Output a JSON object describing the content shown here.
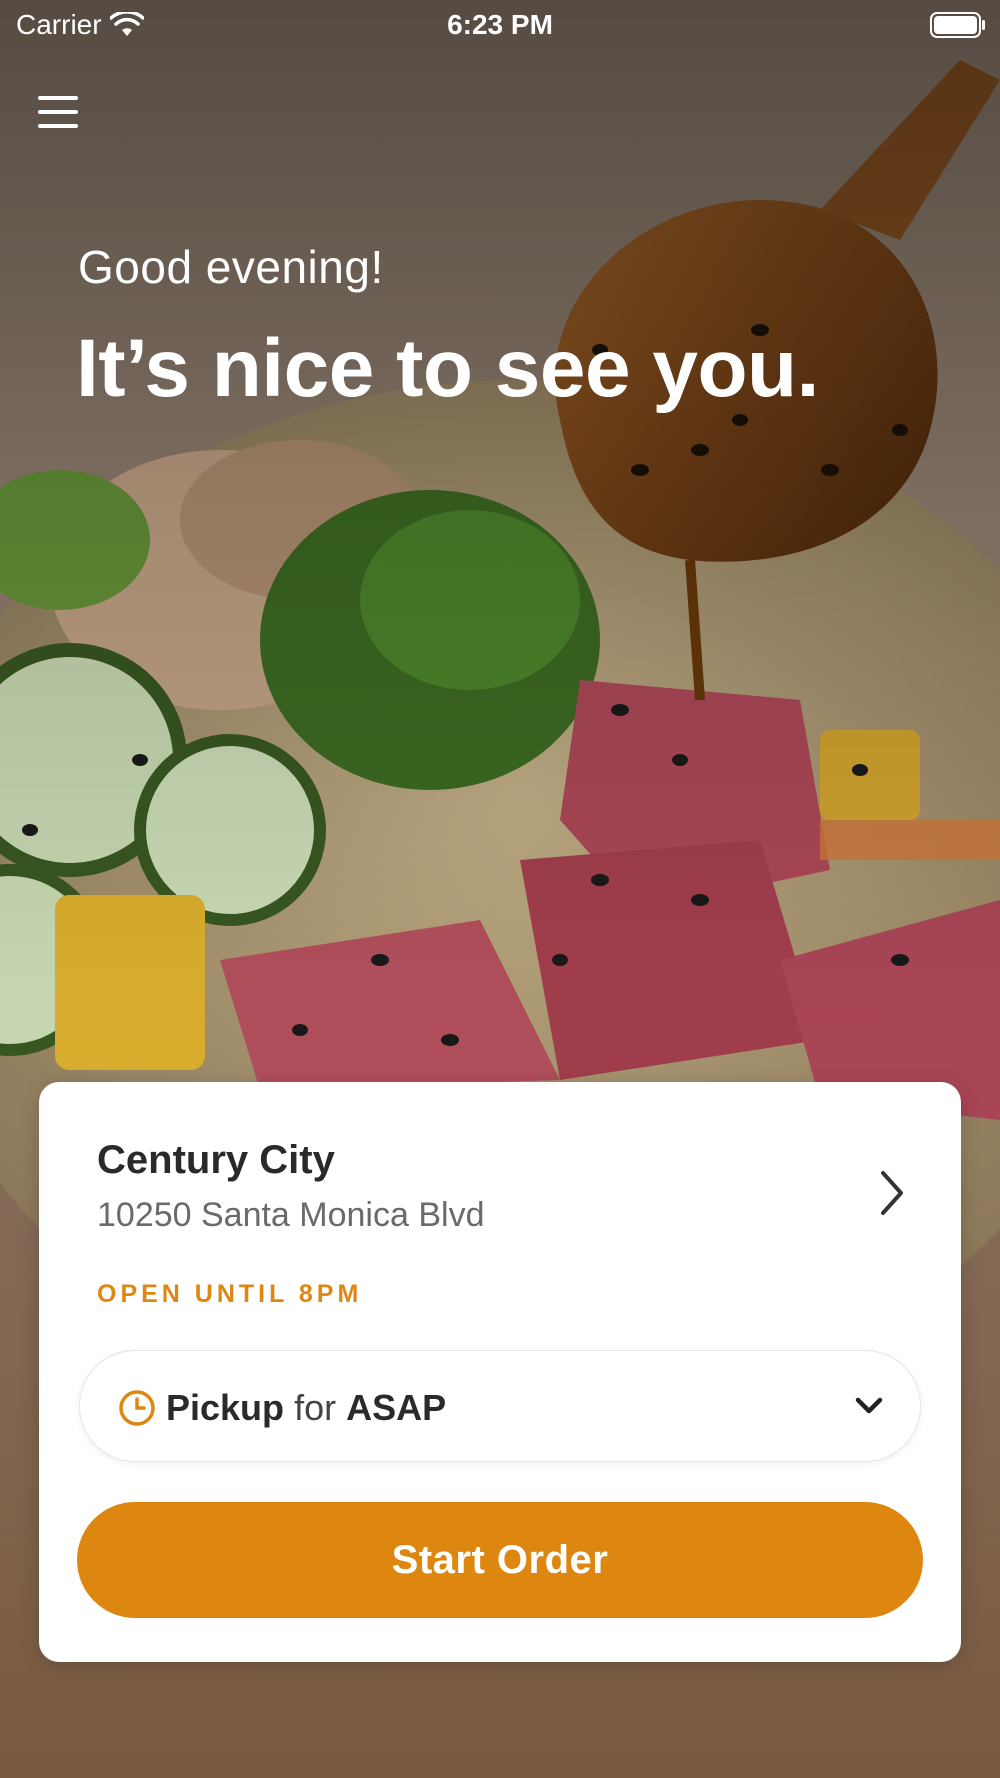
{
  "status_bar": {
    "carrier": "Carrier",
    "time": "6:23 PM"
  },
  "header": {
    "greeting": "Good evening!",
    "headline": "It’s nice to see you."
  },
  "location_card": {
    "name": "Century City",
    "address": "10250 Santa Monica Blvd",
    "hours": "OPEN UNTIL 8PM",
    "pickup": {
      "mode": "Pickup",
      "connector": "for",
      "time": "ASAP"
    },
    "start_button_label": "Start Order"
  },
  "colors": {
    "accent": "#de8710",
    "text_dark": "#2a2a2a",
    "text_muted": "#6a6a6a"
  },
  "icons": [
    "wifi-icon",
    "battery-icon",
    "hamburger-menu-icon",
    "chevron-right-icon",
    "clock-icon",
    "chevron-down-icon"
  ]
}
